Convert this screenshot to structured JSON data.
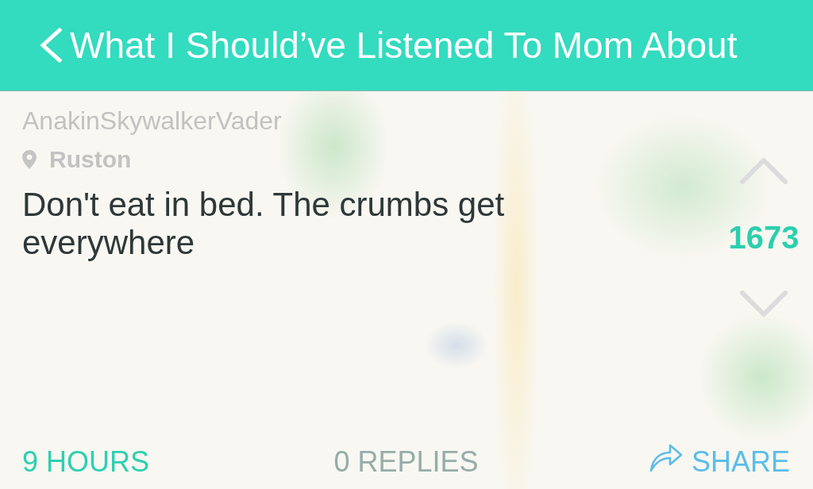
{
  "header": {
    "title": "What I Should’ve Listened To Mom About"
  },
  "post": {
    "username": "AnakinSkywalkerVader",
    "location": "Ruston",
    "message": "Don't eat in bed. The crumbs get everywhere",
    "votes": "1673"
  },
  "footer": {
    "time": "9 HOURS",
    "replies": "0 REPLIES",
    "share": "SHARE"
  }
}
